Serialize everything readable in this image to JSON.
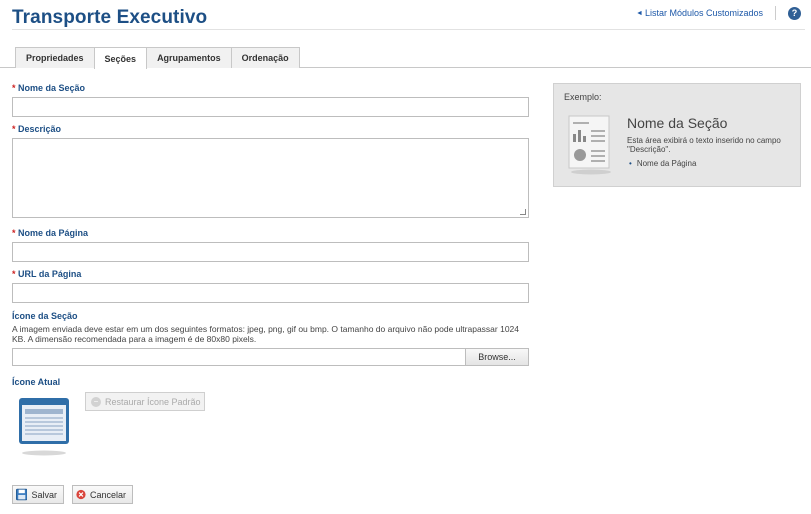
{
  "header": {
    "title": "Transporte Executivo",
    "list_link": "Listar Módulos Customizados",
    "help_icon": "help-icon"
  },
  "tabs": [
    {
      "label": "Propriedades",
      "active": false
    },
    {
      "label": "Seções",
      "active": true
    },
    {
      "label": "Agrupamentos",
      "active": false
    },
    {
      "label": "Ordenação",
      "active": false
    }
  ],
  "form": {
    "required_marker": "*",
    "section_name": {
      "label": "Nome da Seção",
      "value": ""
    },
    "description": {
      "label": "Descrição",
      "value": ""
    },
    "page_name": {
      "label": "Nome da Página",
      "value": ""
    },
    "page_url": {
      "label": "URL da Página",
      "value": ""
    },
    "section_icon": {
      "label": "Ícone da Seção",
      "help": "A imagem enviada deve estar em um dos seguintes formatos: jpeg, png, gif ou bmp. O tamanho do arquivo não pode ultrapassar 1024 KB. A dimensão recomendada para a imagem é de 80x80 pixels.",
      "browse_label": "Browse..."
    },
    "current_icon": {
      "label": "Ícone Atual",
      "restore_label": "Restaurar Ícone Padrão"
    }
  },
  "actions": {
    "save_label": "Salvar",
    "cancel_label": "Cancelar"
  },
  "example": {
    "label": "Exemplo:",
    "title": "Nome da Seção",
    "description": "Esta área exibirá o texto inserido no campo \"Descrição\".",
    "bullet": "Nome da Página"
  },
  "colors": {
    "title_blue": "#1d4f85",
    "link_blue": "#1d58a8",
    "required_red": "#cc2222",
    "example_bg": "#e6e6e6"
  }
}
